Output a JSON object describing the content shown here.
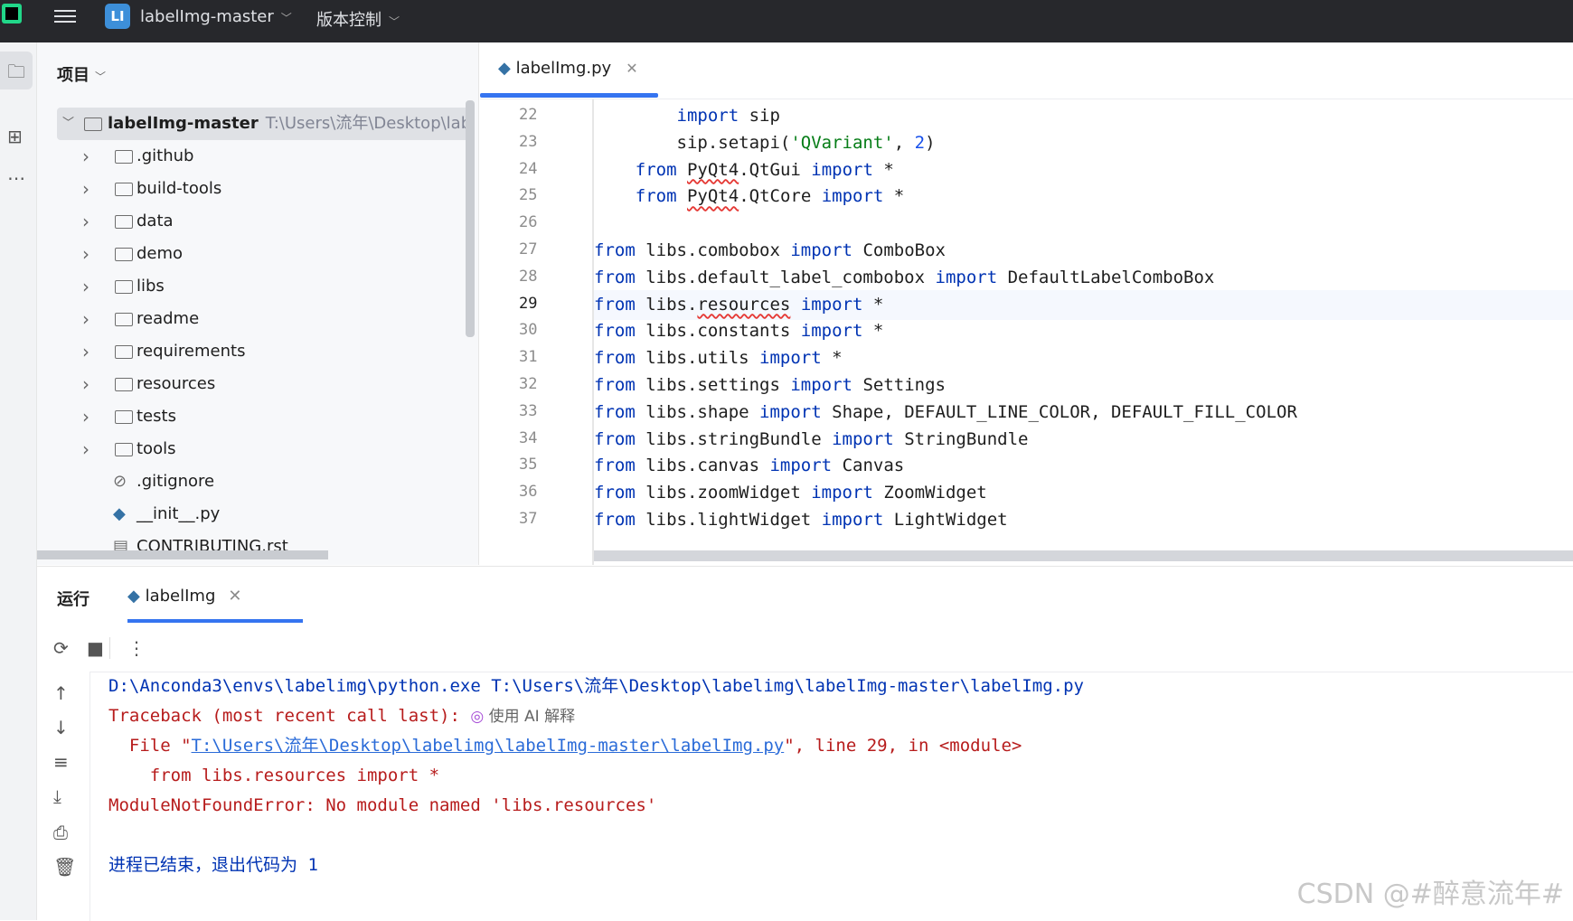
{
  "titlebar": {
    "project_badge": "LI",
    "project_name": "labelImg-master",
    "vcs_label": "版本控制"
  },
  "project_panel": {
    "header": "项目",
    "root": {
      "name": "labelImg-master",
      "path": "T:\\Users\\流年\\Desktop\\labelimg"
    },
    "items": [
      {
        "name": ".github",
        "kind": "folder"
      },
      {
        "name": "build-tools",
        "kind": "folder"
      },
      {
        "name": "data",
        "kind": "folder"
      },
      {
        "name": "demo",
        "kind": "folder"
      },
      {
        "name": "libs",
        "kind": "folder"
      },
      {
        "name": "readme",
        "kind": "folder"
      },
      {
        "name": "requirements",
        "kind": "folder"
      },
      {
        "name": "resources",
        "kind": "folder"
      },
      {
        "name": "tests",
        "kind": "folder"
      },
      {
        "name": "tools",
        "kind": "folder"
      },
      {
        "name": ".gitignore",
        "kind": "file-ignore"
      },
      {
        "name": "__init__.py",
        "kind": "file-python"
      },
      {
        "name": "CONTRIBUTING.rst",
        "kind": "file-rst"
      }
    ]
  },
  "editor": {
    "tab_label": "labelImg.py",
    "current_line": "29",
    "lines": [
      {
        "n": "22",
        "text": "        import sip"
      },
      {
        "n": "23",
        "text": "        sip.setapi('QVariant', 2)"
      },
      {
        "n": "24",
        "text": "    from PyQt4.QtGui import *"
      },
      {
        "n": "25",
        "text": "    from PyQt4.QtCore import *"
      },
      {
        "n": "26",
        "text": ""
      },
      {
        "n": "27",
        "text": "from libs.combobox import ComboBox"
      },
      {
        "n": "28",
        "text": "from libs.default_label_combobox import DefaultLabelComboBox"
      },
      {
        "n": "29",
        "text": "from libs.resources import *"
      },
      {
        "n": "30",
        "text": "from libs.constants import *"
      },
      {
        "n": "31",
        "text": "from libs.utils import *"
      },
      {
        "n": "32",
        "text": "from libs.settings import Settings"
      },
      {
        "n": "33",
        "text": "from libs.shape import Shape, DEFAULT_LINE_COLOR, DEFAULT_FILL_COLOR"
      },
      {
        "n": "34",
        "text": "from libs.stringBundle import StringBundle"
      },
      {
        "n": "35",
        "text": "from libs.canvas import Canvas"
      },
      {
        "n": "36",
        "text": "from libs.zoomWidget import ZoomWidget"
      },
      {
        "n": "37",
        "text": "from libs.lightWidget import LightWidget"
      }
    ]
  },
  "run_panel": {
    "title": "运行",
    "tab_label": "labelImg",
    "console": {
      "cmd": "D:\\Anconda3\\envs\\labelimg\\python.exe T:\\Users\\流年\\Desktop\\labelimg\\labelImg-master\\labelImg.py",
      "traceback": "Traceback (most recent call last):",
      "ai_explain": "使用 AI 解释",
      "file_prefix": "  File \"",
      "file_link": "T:\\Users\\流年\\Desktop\\labelimg\\labelImg-master\\labelImg.py",
      "file_suffix": "\", line 29, in <module>",
      "source_line": "    from libs.resources import *",
      "error": "ModuleNotFoundError: No module named 'libs.resources'",
      "exit_msg": "进程已结束，退出代码为 1"
    }
  },
  "watermark": "CSDN @#醉意流年#",
  "colors": {
    "accent": "#3574f0",
    "keyword": "#0033b3",
    "string": "#067d17",
    "number": "#1750eb",
    "error": "#b71c1c"
  }
}
